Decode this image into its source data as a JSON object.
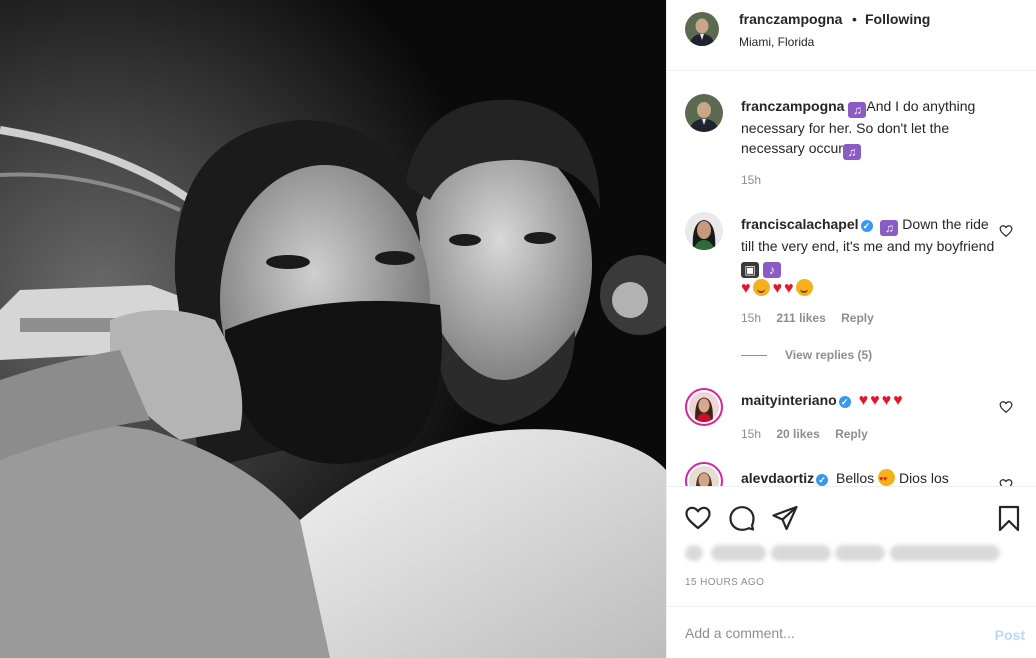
{
  "post": {
    "author": {
      "username": "franczampogna",
      "separator": "•",
      "follow_status": "Following",
      "location": "Miami, Florida"
    },
    "caption": {
      "username": "franczampogna",
      "text": "And I do anything necessary for her. So don't let the necessary occur",
      "time": "15h"
    },
    "comments": [
      {
        "username": "franciscalachapel",
        "verified": true,
        "text_part1": "Down the ride till the very end, it's me and my boyfriend",
        "time": "15h",
        "likes": "211 likes",
        "reply_label": "Reply",
        "view_replies": "View replies (5)"
      },
      {
        "username": "maityinteriano",
        "verified": true,
        "time": "15h",
        "likes": "20 likes",
        "reply_label": "Reply"
      },
      {
        "username": "alevdaortiz",
        "verified": true,
        "text_part1": "Bellos",
        "text_part2": "Dios los"
      }
    ],
    "actions": {
      "like_icon": "heart-outline-icon",
      "comment_icon": "speech-bubble-icon",
      "share_icon": "paper-plane-icon",
      "save_icon": "bookmark-icon"
    },
    "timestamp": "15 HOURS AGO",
    "add_comment": {
      "placeholder": "Add a comment...",
      "post_label": "Post"
    },
    "colors": {
      "link_blue": "#b3dbff",
      "verified_blue": "#3897f0",
      "muted_text": "#8e8e8e",
      "story_ring": "#d6249f",
      "heart_red": "#e8142c"
    }
  }
}
